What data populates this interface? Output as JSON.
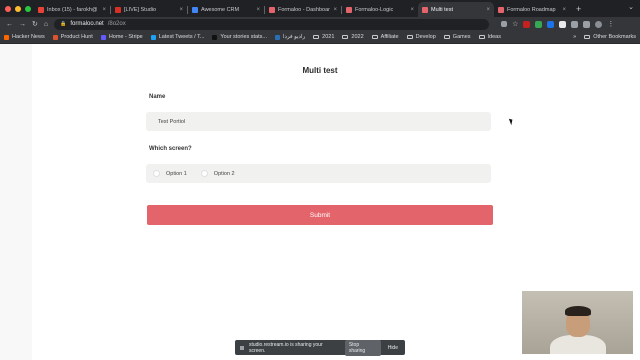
{
  "browser": {
    "tabs": [
      {
        "title": "Inbox (15) - farokh@",
        "favicon_color": "#ea4335",
        "active": false
      },
      {
        "title": "[LIVE] Studio",
        "favicon_color": "#d93025",
        "active": false
      },
      {
        "title": "Awesome CRM",
        "favicon_color": "#4285f4",
        "active": false
      },
      {
        "title": "Formaloo - Dashboard",
        "favicon_color": "#e4646b",
        "active": false
      },
      {
        "title": "Formaloo-Logic",
        "favicon_color": "#e4646b",
        "active": false
      },
      {
        "title": "Multi test",
        "favicon_color": "#e4646b",
        "active": true
      },
      {
        "title": "Formaloo Roadmap",
        "favicon_color": "#e4646b",
        "active": false
      }
    ],
    "new_tab": "+",
    "url_host": "formaloo.net",
    "url_path": "/8o2ox",
    "bookmarks": [
      {
        "label": "Hacker News",
        "color": "#ff6600"
      },
      {
        "label": "Product Hunt",
        "color": "#da552f"
      },
      {
        "label": "Home - Stripe",
        "color": "#635bff"
      },
      {
        "label": "Latest Tweets / T...",
        "color": "#1da1f2"
      },
      {
        "label": "Your stories stats...",
        "color": "#111111"
      },
      {
        "label": "راديو فردا",
        "color": "#2a6fb6"
      },
      {
        "label": "2021",
        "folder": true
      },
      {
        "label": "2022",
        "folder": true
      },
      {
        "label": "Affiliate",
        "folder": true
      },
      {
        "label": "Develop",
        "folder": true
      },
      {
        "label": "Games",
        "folder": true
      },
      {
        "label": "Ideas",
        "folder": true
      }
    ],
    "bookmarks_more": "»",
    "other_bookmarks": "Other Bookmarks"
  },
  "form": {
    "title": "Multi test",
    "name_label": "Name",
    "name_value": "Test Portiol",
    "screen_label": "Which screen?",
    "options": [
      "Option 1",
      "Option 2"
    ],
    "submit_label": "Submit"
  },
  "share_banner": {
    "text": "studio.restream.io is sharing your screen.",
    "stop_label": "Stop sharing",
    "hide_label": "Hide"
  },
  "colors": {
    "submit": "#e4646b",
    "field_bg": "#f1f1ef"
  }
}
